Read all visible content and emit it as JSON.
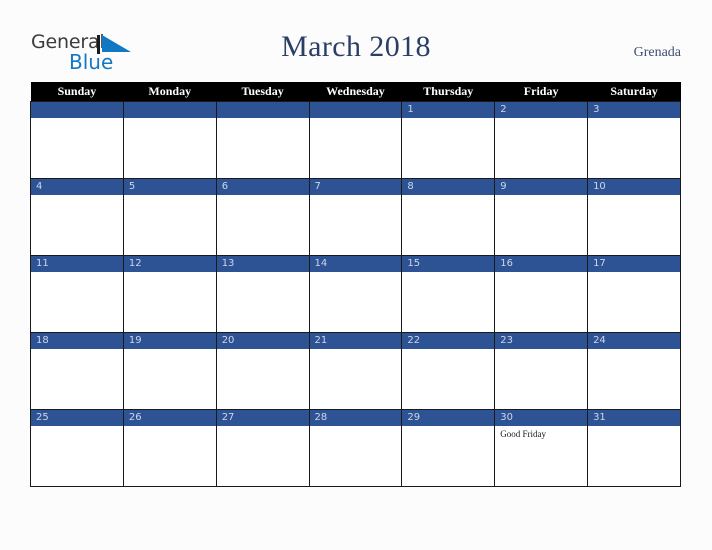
{
  "brand": {
    "word_one": "General",
    "word_two": "Blue",
    "triangle_icon": "blue-triangle-icon",
    "color_general": "#3b3b3b",
    "color_blue": "#1278c4"
  },
  "header": {
    "title": "March 2018",
    "region": "Grenada",
    "title_color": "#2b3f66"
  },
  "calendar": {
    "month": "March",
    "year": "2018",
    "accent_color": "#2e5395",
    "header_bg": "#000000",
    "weekday_headers": [
      "Sunday",
      "Monday",
      "Tuesday",
      "Wednesday",
      "Thursday",
      "Friday",
      "Saturday"
    ],
    "weeks": [
      [
        {
          "date": "",
          "events": []
        },
        {
          "date": "",
          "events": []
        },
        {
          "date": "",
          "events": []
        },
        {
          "date": "",
          "events": []
        },
        {
          "date": "1",
          "events": []
        },
        {
          "date": "2",
          "events": []
        },
        {
          "date": "3",
          "events": []
        }
      ],
      [
        {
          "date": "4",
          "events": []
        },
        {
          "date": "5",
          "events": []
        },
        {
          "date": "6",
          "events": []
        },
        {
          "date": "7",
          "events": []
        },
        {
          "date": "8",
          "events": []
        },
        {
          "date": "9",
          "events": []
        },
        {
          "date": "10",
          "events": []
        }
      ],
      [
        {
          "date": "11",
          "events": []
        },
        {
          "date": "12",
          "events": []
        },
        {
          "date": "13",
          "events": []
        },
        {
          "date": "14",
          "events": []
        },
        {
          "date": "15",
          "events": []
        },
        {
          "date": "16",
          "events": []
        },
        {
          "date": "17",
          "events": []
        }
      ],
      [
        {
          "date": "18",
          "events": []
        },
        {
          "date": "19",
          "events": []
        },
        {
          "date": "20",
          "events": []
        },
        {
          "date": "21",
          "events": []
        },
        {
          "date": "22",
          "events": []
        },
        {
          "date": "23",
          "events": []
        },
        {
          "date": "24",
          "events": []
        }
      ],
      [
        {
          "date": "25",
          "events": []
        },
        {
          "date": "26",
          "events": []
        },
        {
          "date": "27",
          "events": []
        },
        {
          "date": "28",
          "events": []
        },
        {
          "date": "29",
          "events": []
        },
        {
          "date": "30",
          "events": [
            "Good Friday"
          ]
        },
        {
          "date": "31",
          "events": []
        }
      ]
    ]
  }
}
